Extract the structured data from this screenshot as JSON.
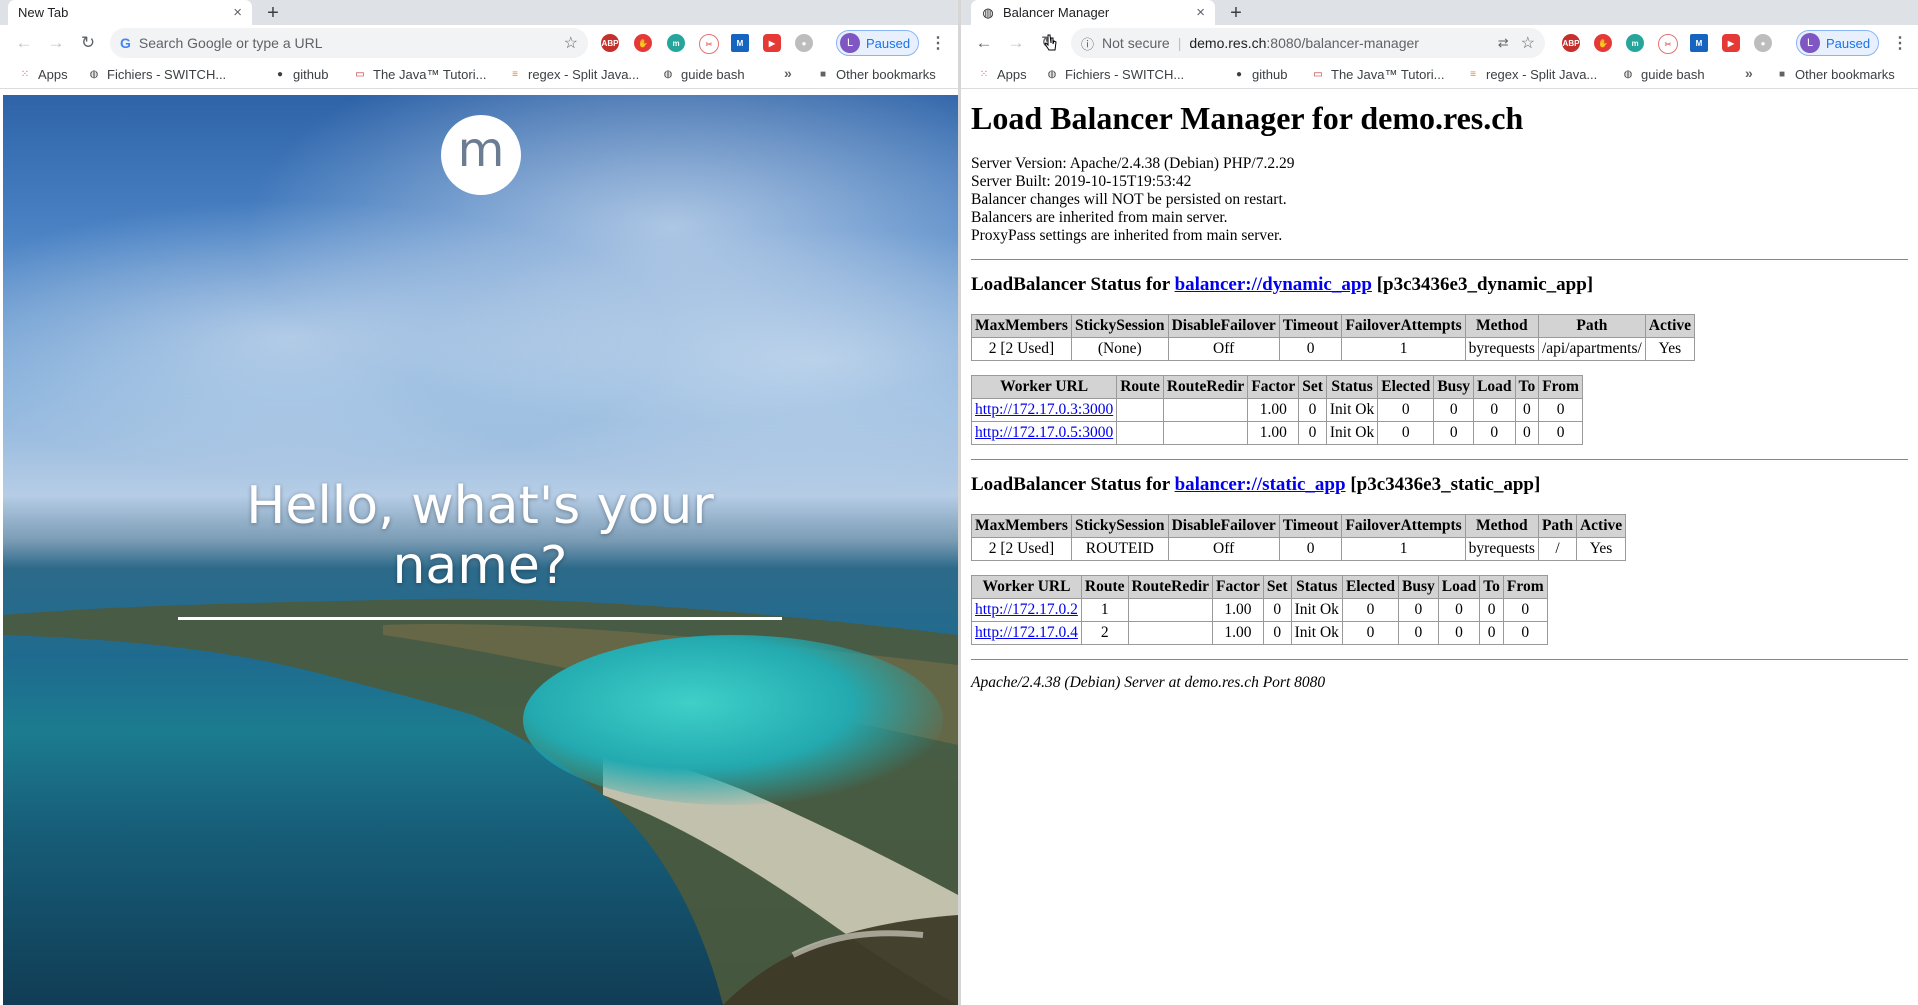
{
  "left_window": {
    "tab": {
      "title": "New Tab",
      "close": "×"
    },
    "new_tab": "+",
    "toolbar": {
      "back": "←",
      "forward": "→",
      "reload": "↻",
      "omnibox_placeholder": "Search Google or type a URL",
      "star": "☆"
    },
    "profile": {
      "initial": "L",
      "label": "Paused"
    },
    "bookmarks": {
      "items": [
        {
          "label": "Apps"
        },
        {
          "label": "Fichiers - SWITCH..."
        },
        {
          "label": "github"
        },
        {
          "label": "The Java™ Tutori..."
        },
        {
          "label": "regex - Split Java..."
        },
        {
          "label": "guide bash"
        }
      ],
      "more": "»",
      "other": "Other bookmarks"
    },
    "ntp": {
      "logo_letter": "m",
      "greeting": "Hello, what's your name?"
    }
  },
  "right_window": {
    "tab": {
      "title": "Balancer Manager",
      "close": "×"
    },
    "new_tab": "+",
    "toolbar": {
      "back": "←",
      "forward": "→",
      "reload": "↻",
      "security": "Not secure",
      "url_host": "demo.res.ch",
      "url_path": ":8080/balancer-manager",
      "star": "☆"
    },
    "profile": {
      "initial": "L",
      "label": "Paused"
    },
    "bookmarks": {
      "items": [
        {
          "label": "Apps"
        },
        {
          "label": "Fichiers - SWITCH..."
        },
        {
          "label": "github"
        },
        {
          "label": "The Java™ Tutori..."
        },
        {
          "label": "regex - Split Java..."
        },
        {
          "label": "guide bash"
        }
      ],
      "more": "»",
      "other": "Other bookmarks"
    },
    "page": {
      "title": "Load Balancer Manager for demo.res.ch",
      "info": [
        "Server Version: Apache/2.4.38 (Debian) PHP/7.2.29",
        "Server Built: 2019-10-15T19:53:42",
        "Balancer changes will NOT be persisted on restart.",
        "Balancers are inherited from main server.",
        "ProxyPass settings are inherited from main server."
      ],
      "balancers": [
        {
          "heading_prefix": "LoadBalancer Status for ",
          "link": "balancer://dynamic_app",
          "suffix": " [p3c3436e3_dynamic_app]",
          "status_headers": [
            "MaxMembers",
            "StickySession",
            "DisableFailover",
            "Timeout",
            "FailoverAttempts",
            "Method",
            "Path",
            "Active"
          ],
          "status_row": [
            "2 [2 Used]",
            "(None)",
            "Off",
            "0",
            "1",
            "byrequests",
            "/api/apartments/",
            "Yes"
          ],
          "worker_headers": [
            "Worker URL",
            "Route",
            "RouteRedir",
            "Factor",
            "Set",
            "Status",
            "Elected",
            "Busy",
            "Load",
            "To",
            "From"
          ],
          "workers": [
            [
              "http://172.17.0.3:3000",
              "",
              "",
              "1.00",
              "0",
              "Init Ok",
              "0",
              "0",
              "0",
              "0",
              "0"
            ],
            [
              "http://172.17.0.5:3000",
              "",
              "",
              "1.00",
              "0",
              "Init Ok",
              "0",
              "0",
              "0",
              "0",
              "0"
            ]
          ]
        },
        {
          "heading_prefix": "LoadBalancer Status for ",
          "link": "balancer://static_app",
          "suffix": " [p3c3436e3_static_app]",
          "status_headers": [
            "MaxMembers",
            "StickySession",
            "DisableFailover",
            "Timeout",
            "FailoverAttempts",
            "Method",
            "Path",
            "Active"
          ],
          "status_row": [
            "2 [2 Used]",
            "ROUTEID",
            "Off",
            "0",
            "1",
            "byrequests",
            "/",
            "Yes"
          ],
          "worker_headers": [
            "Worker URL",
            "Route",
            "RouteRedir",
            "Factor",
            "Set",
            "Status",
            "Elected",
            "Busy",
            "Load",
            "To",
            "From"
          ],
          "workers": [
            [
              "http://172.17.0.2",
              "1",
              "",
              "1.00",
              "0",
              "Init Ok",
              "0",
              "0",
              "0",
              "0",
              "0"
            ],
            [
              "http://172.17.0.4",
              "2",
              "",
              "1.00",
              "0",
              "Init Ok",
              "0",
              "0",
              "0",
              "0",
              "0"
            ]
          ]
        }
      ],
      "footer": "Apache/2.4.38 (Debian) Server at demo.res.ch Port 8080"
    }
  },
  "colors": {
    "link": "#0000ee",
    "table_header_bg": "#d3d3d3",
    "tabstrip_bg": "#dee1e6",
    "profile_accent": "#1a73e8"
  }
}
